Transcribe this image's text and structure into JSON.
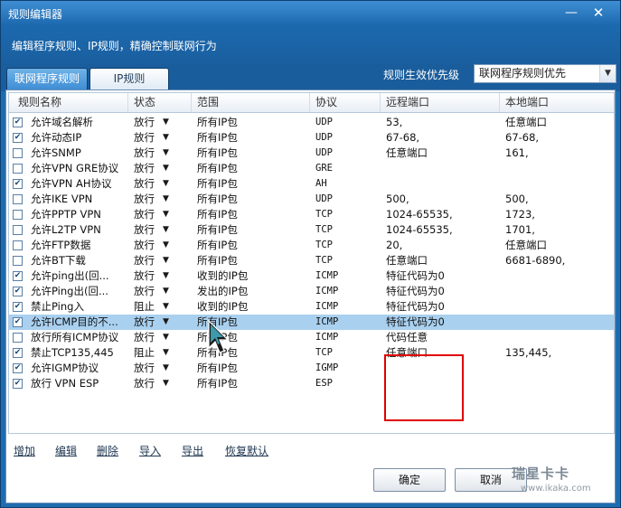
{
  "window": {
    "title": "规则编辑器",
    "minimize_glyph": "—",
    "close_glyph": "✕",
    "subtitle": "编辑程序规则、IP规则，精确控制联网行为"
  },
  "tabs": [
    {
      "label": "联网程序规则",
      "active": true
    },
    {
      "label": "IP规则",
      "active": false
    }
  ],
  "priority": {
    "label": "规则生效优先级",
    "selected": "联网程序规则优先"
  },
  "grid": {
    "columns": [
      "规则名称",
      "状态",
      "范围",
      "协议",
      "远程端口",
      "本地端口"
    ],
    "rows": [
      {
        "checked": true,
        "name": "允许域名解析",
        "status": "放行",
        "scope": "所有IP包",
        "protocol": "UDP",
        "remote": "53,",
        "local": "任意端口"
      },
      {
        "checked": true,
        "name": "允许动态IP",
        "status": "放行",
        "scope": "所有IP包",
        "protocol": "UDP",
        "remote": "67-68,",
        "local": "67-68,"
      },
      {
        "checked": false,
        "name": "允许SNMP",
        "status": "放行",
        "scope": "所有IP包",
        "protocol": "UDP",
        "remote": "任意端口",
        "local": "161,"
      },
      {
        "checked": false,
        "name": "允许VPN GRE协议",
        "status": "放行",
        "scope": "所有IP包",
        "protocol": "GRE",
        "remote": "",
        "local": ""
      },
      {
        "checked": true,
        "name": "允许VPN AH协议",
        "status": "放行",
        "scope": "所有IP包",
        "protocol": "AH",
        "remote": "",
        "local": ""
      },
      {
        "checked": false,
        "name": "允许IKE VPN",
        "status": "放行",
        "scope": "所有IP包",
        "protocol": "UDP",
        "remote": "500,",
        "local": "500,"
      },
      {
        "checked": false,
        "name": "允许PPTP VPN",
        "status": "放行",
        "scope": "所有IP包",
        "protocol": "TCP",
        "remote": "1024-65535,",
        "local": "1723,"
      },
      {
        "checked": false,
        "name": "允许L2TP VPN",
        "status": "放行",
        "scope": "所有IP包",
        "protocol": "TCP",
        "remote": "1024-65535,",
        "local": "1701,"
      },
      {
        "checked": false,
        "name": "允许FTP数据",
        "status": "放行",
        "scope": "所有IP包",
        "protocol": "TCP",
        "remote": "20,",
        "local": "任意端口"
      },
      {
        "checked": false,
        "name": "允许BT下载",
        "status": "放行",
        "scope": "所有IP包",
        "protocol": "TCP",
        "remote": "任意端口",
        "local": "6681-6890,"
      },
      {
        "checked": true,
        "name": "允许ping出(回...",
        "status": "放行",
        "scope": "收到的IP包",
        "protocol": "ICMP",
        "remote": "特征代码为0",
        "local": ""
      },
      {
        "checked": true,
        "name": "允许Ping出(回...",
        "status": "放行",
        "scope": "发出的IP包",
        "protocol": "ICMP",
        "remote": "特征代码为0",
        "local": ""
      },
      {
        "checked": true,
        "name": "禁止Ping入",
        "status": "阻止",
        "scope": "收到的IP包",
        "protocol": "ICMP",
        "remote": "特征代码为0",
        "local": ""
      },
      {
        "checked": true,
        "name": "允许ICMP目的不...",
        "status": "放行",
        "scope": "所有IP包",
        "protocol": "ICMP",
        "remote": "特征代码为0",
        "local": "",
        "selected": true
      },
      {
        "checked": false,
        "name": "放行所有ICMP协议",
        "status": "放行",
        "scope": "所有IP包",
        "protocol": "ICMP",
        "remote": "代码任意",
        "local": ""
      },
      {
        "checked": true,
        "name": "禁止TCP135,445",
        "status": "阻止",
        "scope": "所有IP包",
        "protocol": "TCP",
        "remote": "任意端口",
        "local": "135,445,"
      },
      {
        "checked": true,
        "name": "允许IGMP协议",
        "status": "放行",
        "scope": "所有IP包",
        "protocol": "IGMP",
        "remote": "",
        "local": ""
      },
      {
        "checked": true,
        "name": "放行 VPN ESP",
        "status": "放行",
        "scope": "所有IP包",
        "protocol": "ESP",
        "remote": "",
        "local": ""
      }
    ]
  },
  "actions": [
    "增加",
    "编辑",
    "删除",
    "导入",
    "导出",
    "恢复默认"
  ],
  "buttons": {
    "ok": "确定",
    "cancel": "取消"
  },
  "watermark": {
    "main": "瑞星卡卡",
    "sub": "www.ikaka.com"
  },
  "icons": {
    "checkbox_check": "✔",
    "dropdown": "▼"
  },
  "colors": {
    "titlebar": "#1e6cb0",
    "selected_row": "#a9d0ef",
    "highlight_box": "#e00000"
  }
}
